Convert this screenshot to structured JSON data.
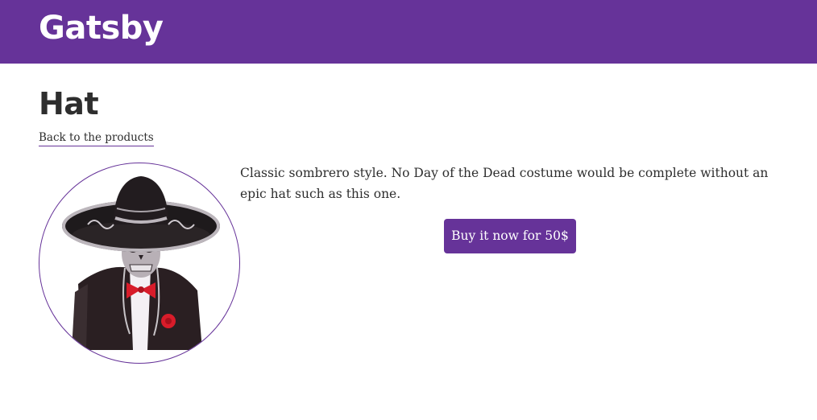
{
  "header": {
    "site_title": "Gatsby",
    "background_color": "#663399"
  },
  "product": {
    "title": "Hat",
    "back_link_label": "Back to the products",
    "image_icon": "sombrero-skeleton-image",
    "description": "Classic sombrero style. No Day of the Dead costume would be complete without an epic hat such as this one.",
    "buy_button_label": "Buy it now for 50$"
  },
  "colors": {
    "accent": "#663399",
    "text": "#2e2e2e",
    "background": "#ffffff"
  }
}
